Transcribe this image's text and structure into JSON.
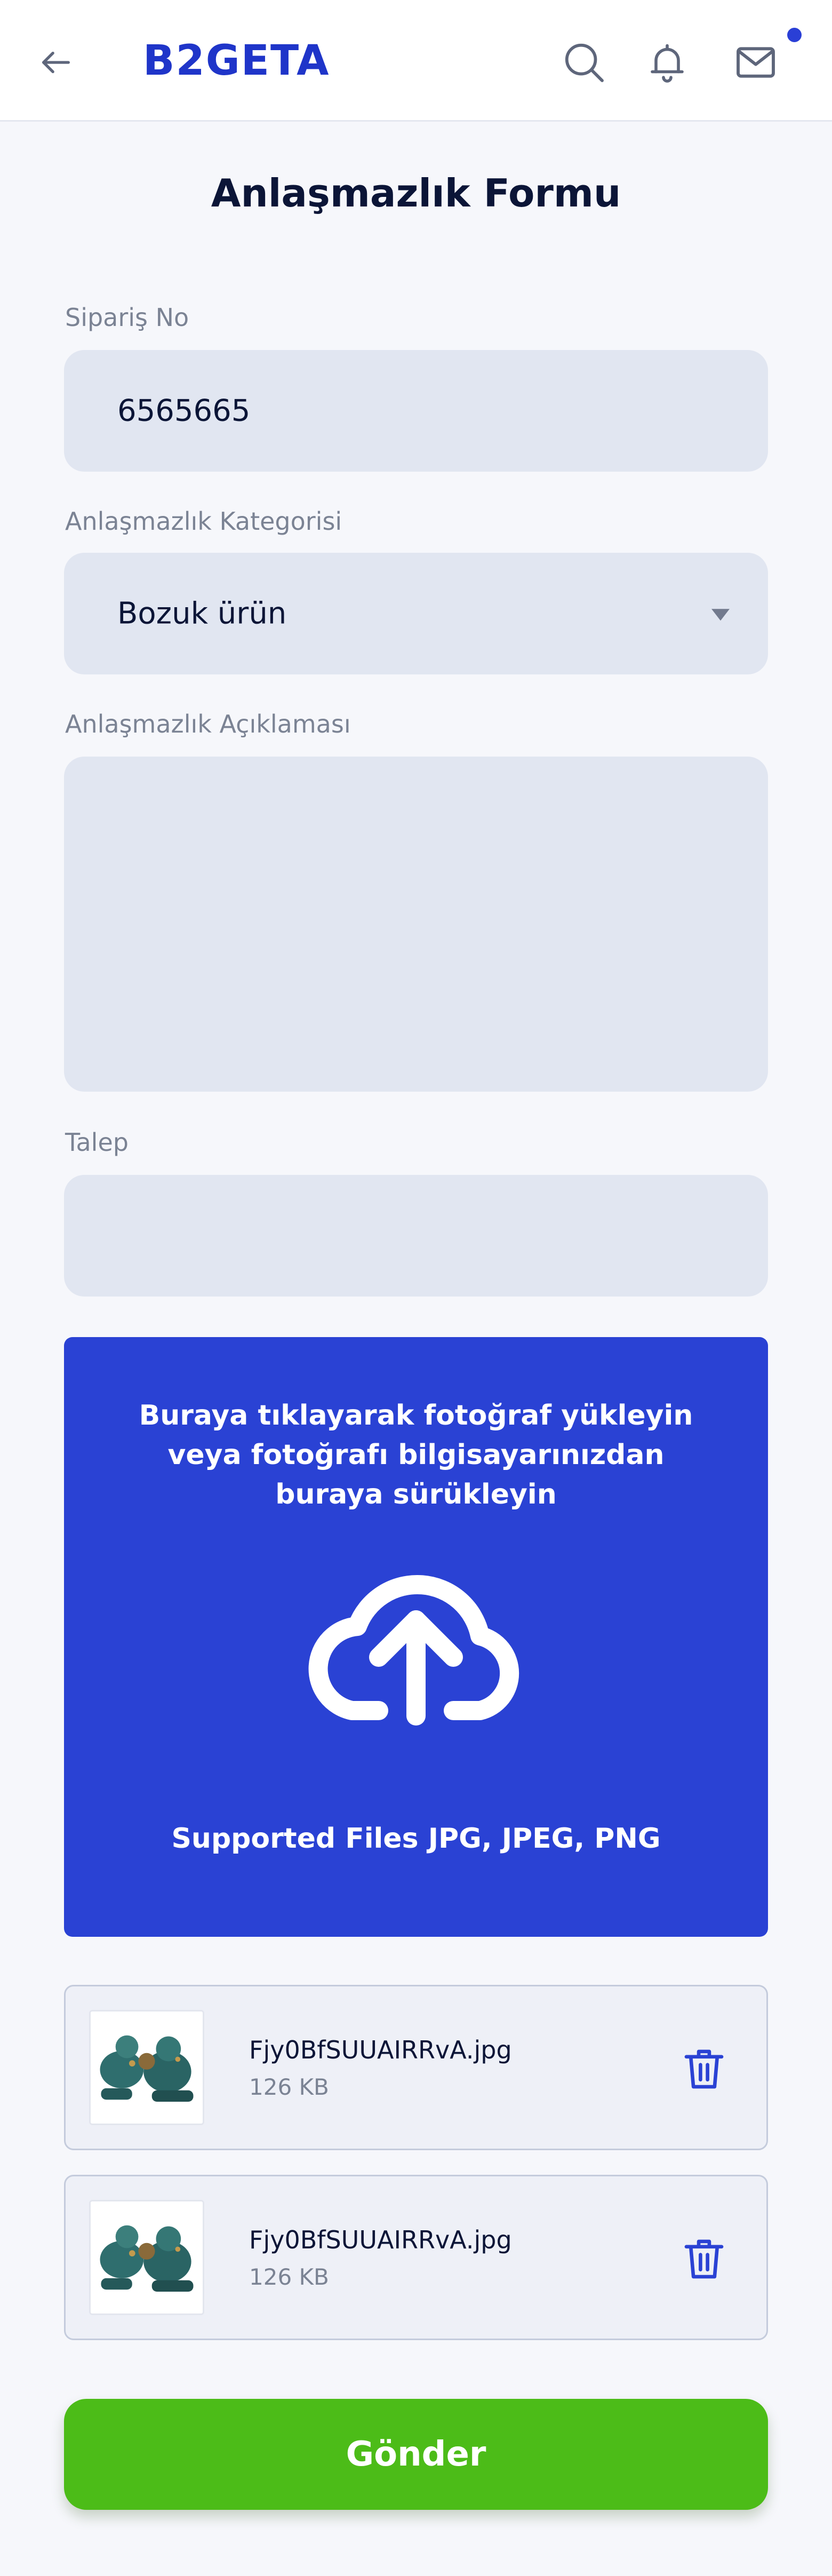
{
  "header": {
    "logo_text": "B2GETA",
    "back_icon": "arrow-left-icon",
    "search_icon": "search-icon",
    "bell_icon": "bell-icon",
    "mail_icon": "mail-icon",
    "accent_color": "#2a42d4"
  },
  "page": {
    "title": "Anlaşmazlık Formu"
  },
  "form": {
    "order_no": {
      "label": "Sipariş No",
      "value": "6565665"
    },
    "category": {
      "label": "Anlaşmazlık Kategorisi",
      "selected": "Bozuk ürün"
    },
    "description": {
      "label": "Anlaşmazlık Açıklaması",
      "value": ""
    },
    "request": {
      "label": "Talep",
      "value": ""
    }
  },
  "upload": {
    "instruction": "Buraya tıklayarak fotoğraf yükleyin veya fotoğrafı bilgisayarınızdan buraya sürükleyin",
    "supported": "Supported Files JPG, JPEG, PNG",
    "icon": "cloud-upload-icon",
    "color": "#2a42d4"
  },
  "files": [
    {
      "name": "Fjy0BfSUUAIRRvA.jpg",
      "size": "126 KB"
    },
    {
      "name": "Fjy0BfSUUAIRRvA.jpg",
      "size": "126 KB"
    }
  ],
  "submit": {
    "label": "Gönder",
    "color": "#4cbc18"
  }
}
